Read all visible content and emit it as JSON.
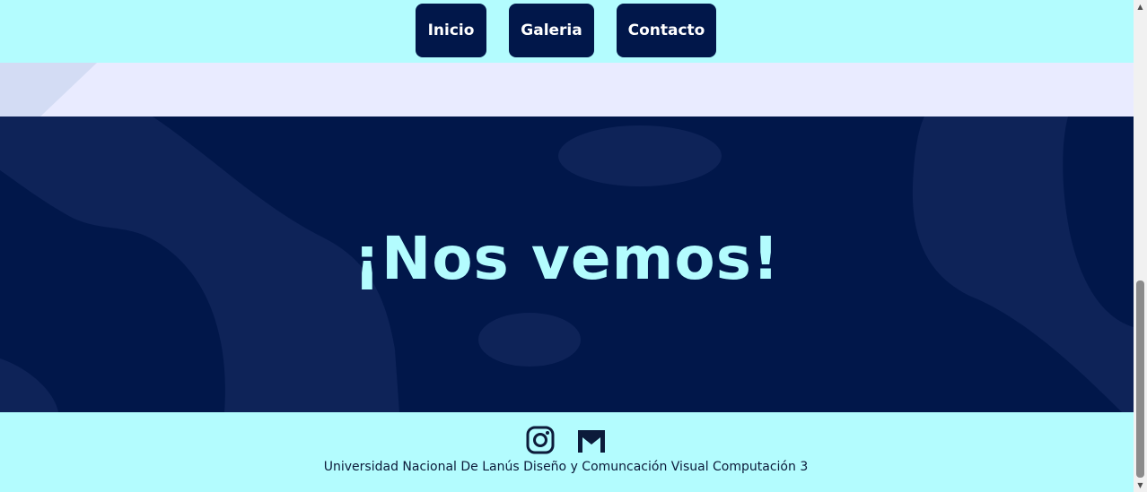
{
  "nav": {
    "items": [
      {
        "label": "Inicio"
      },
      {
        "label": "Galeria"
      },
      {
        "label": "Contacto"
      }
    ]
  },
  "hero": {
    "title": "¡Nos vemos!"
  },
  "footer": {
    "icons": [
      "instagram-icon",
      "mail-icon"
    ],
    "text": "Universidad Nacional De Lanús Diseño y Comuncación Visual Computación 3"
  },
  "colors": {
    "nav_background": "#b3fcfe",
    "button_background": "#01174a",
    "hero_background": "#01174a",
    "hero_title": "#b3fcfe",
    "band_background": "#e9ebff"
  }
}
